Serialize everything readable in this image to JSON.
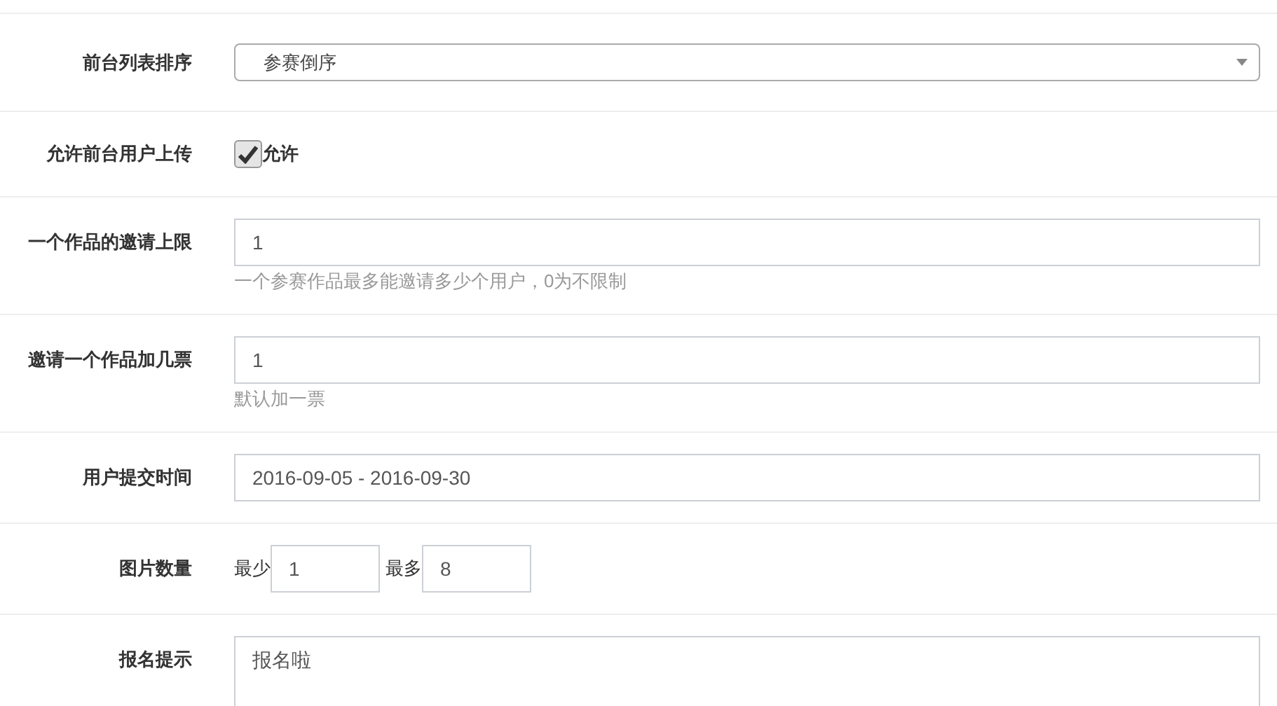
{
  "rows": [
    {
      "kind": "select",
      "label": "前台列表排序",
      "value": "参赛倒序"
    },
    {
      "kind": "checkbox",
      "label": "允许前台用户上传",
      "option": "允许",
      "checked": true
    },
    {
      "kind": "input",
      "label": "一个作品的邀请上限",
      "value": "1",
      "help": "一个参赛作品最多能邀请多少个用户，0为不限制"
    },
    {
      "kind": "input",
      "label": "邀请一个作品加几票",
      "value": "1",
      "help": "默认加一票"
    },
    {
      "kind": "input",
      "label": "用户提交时间",
      "value": "2016-09-05 - 2016-09-30"
    },
    {
      "kind": "range",
      "label": "图片数量",
      "min_label": "最少",
      "min_value": "1",
      "max_label": "最多",
      "max_value": "8"
    },
    {
      "kind": "textarea",
      "label": "报名提示",
      "value": "报名啦"
    }
  ]
}
